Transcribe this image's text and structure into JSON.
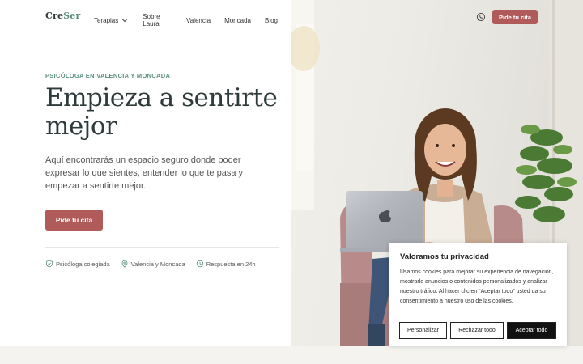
{
  "brand": {
    "logo_part1": "Cre",
    "logo_part2": "Ser"
  },
  "nav": {
    "items": [
      {
        "label": "Terapias",
        "has_dropdown": true
      },
      {
        "label": "Sobre Laura"
      },
      {
        "label": "Valencia"
      },
      {
        "label": "Moncada"
      },
      {
        "label": "Blog"
      }
    ]
  },
  "header": {
    "whatsapp_icon": "whatsapp-icon",
    "cta_label": "Pide tu cita"
  },
  "hero": {
    "eyebrow": "PSICÓLOGA EN VALENCIA Y MONCADA",
    "title": "Empieza a sentirte mejor",
    "description": "Aquí encontrarás un espacio seguro donde poder expresar lo que sientes, entender lo que te pasa y empezar a sentirte mejor.",
    "cta_label": "Pide tu cita"
  },
  "badges": [
    {
      "icon": "shield-check-icon",
      "label": "Psicóloga colegiada"
    },
    {
      "icon": "map-pin-icon",
      "label": "Valencia y Moncada"
    },
    {
      "icon": "clock-icon",
      "label": "Respuesta en 24h"
    }
  ],
  "cookie_banner": {
    "title": "Valoramos tu privacidad",
    "text": "Usamos cookies para mejorar su experiencia de navegación, mostrarle anuncios o contenidos personalizados y analizar nuestro tráfico. Al hacer clic en “Aceptar todo” usted da su consentimiento a nuestro uso de las cookies.",
    "customize_label": "Personalizar",
    "reject_label": "Rechazar todo",
    "accept_label": "Aceptar todo"
  },
  "colors": {
    "accent_green": "#5b8f7a",
    "cta_red": "#b15a5a",
    "heading": "#2f3a3a"
  }
}
